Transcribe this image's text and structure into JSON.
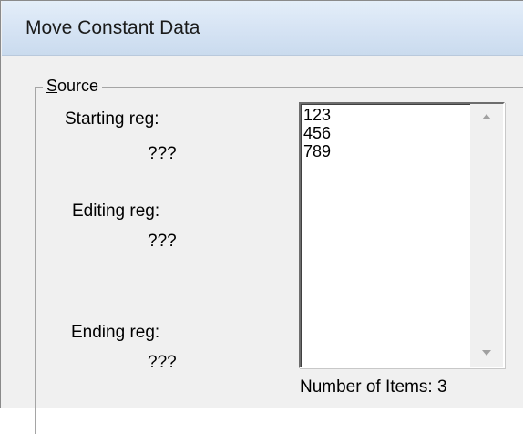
{
  "window": {
    "title": "Move Constant Data"
  },
  "source": {
    "group_label": "Source",
    "group_label_mnemonic": "S",
    "group_label_rest": "ource",
    "starting_reg_label": "Starting reg:",
    "starting_reg_value": "???",
    "editing_reg_label": "Editing reg:",
    "editing_reg_value": "???",
    "ending_reg_label": "Ending reg:",
    "ending_reg_value": "???"
  },
  "list": {
    "items": [
      "123",
      "456",
      "789"
    ],
    "scroll_up_icon": "scroll-up-arrow",
    "scroll_down_icon": "scroll-down-arrow"
  },
  "count_label": "Number of Items: 3"
}
